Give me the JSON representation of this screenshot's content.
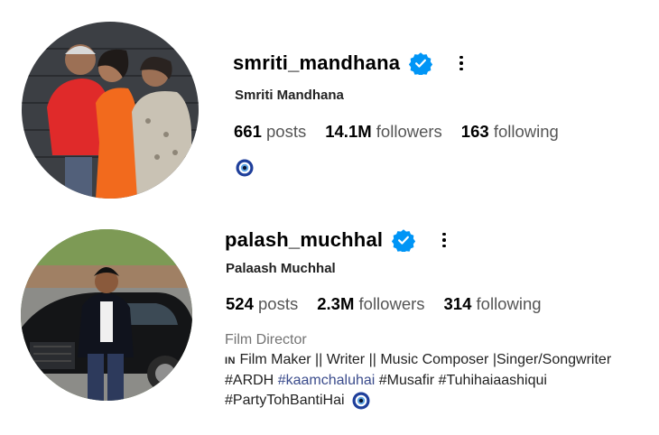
{
  "profiles": [
    {
      "username": "smriti_mandhana",
      "full_name": "Smriti Mandhana",
      "stats": [
        {
          "value": "661",
          "label": "posts"
        },
        {
          "value": "14.1M",
          "label": "followers"
        },
        {
          "value": "163",
          "label": "following"
        }
      ],
      "bio_emoji": "nazar-amulet-icon"
    },
    {
      "username": "palash_muchhal",
      "full_name": "Palaash Muchhal",
      "stats": [
        {
          "value": "524",
          "label": "posts"
        },
        {
          "value": "2.3M",
          "label": "followers"
        },
        {
          "value": "314",
          "label": "following"
        }
      ],
      "category": "Film Director",
      "bio_line1_flag": "IN",
      "bio_line1": "Film Maker || Writer || Music Composer |Singer/Songwriter",
      "bio_line2_a": "#ARDH",
      "bio_line2_link": "#kaamchaluhai",
      "bio_line2_b": "#Musafir #Tuhihaiaashiqui",
      "bio_line3": "#PartyTohBantiHai"
    }
  ],
  "colors": {
    "verified_blue": "#0095f6",
    "hashtag_link": "#3b4c8c",
    "secondary_text": "#737373"
  }
}
